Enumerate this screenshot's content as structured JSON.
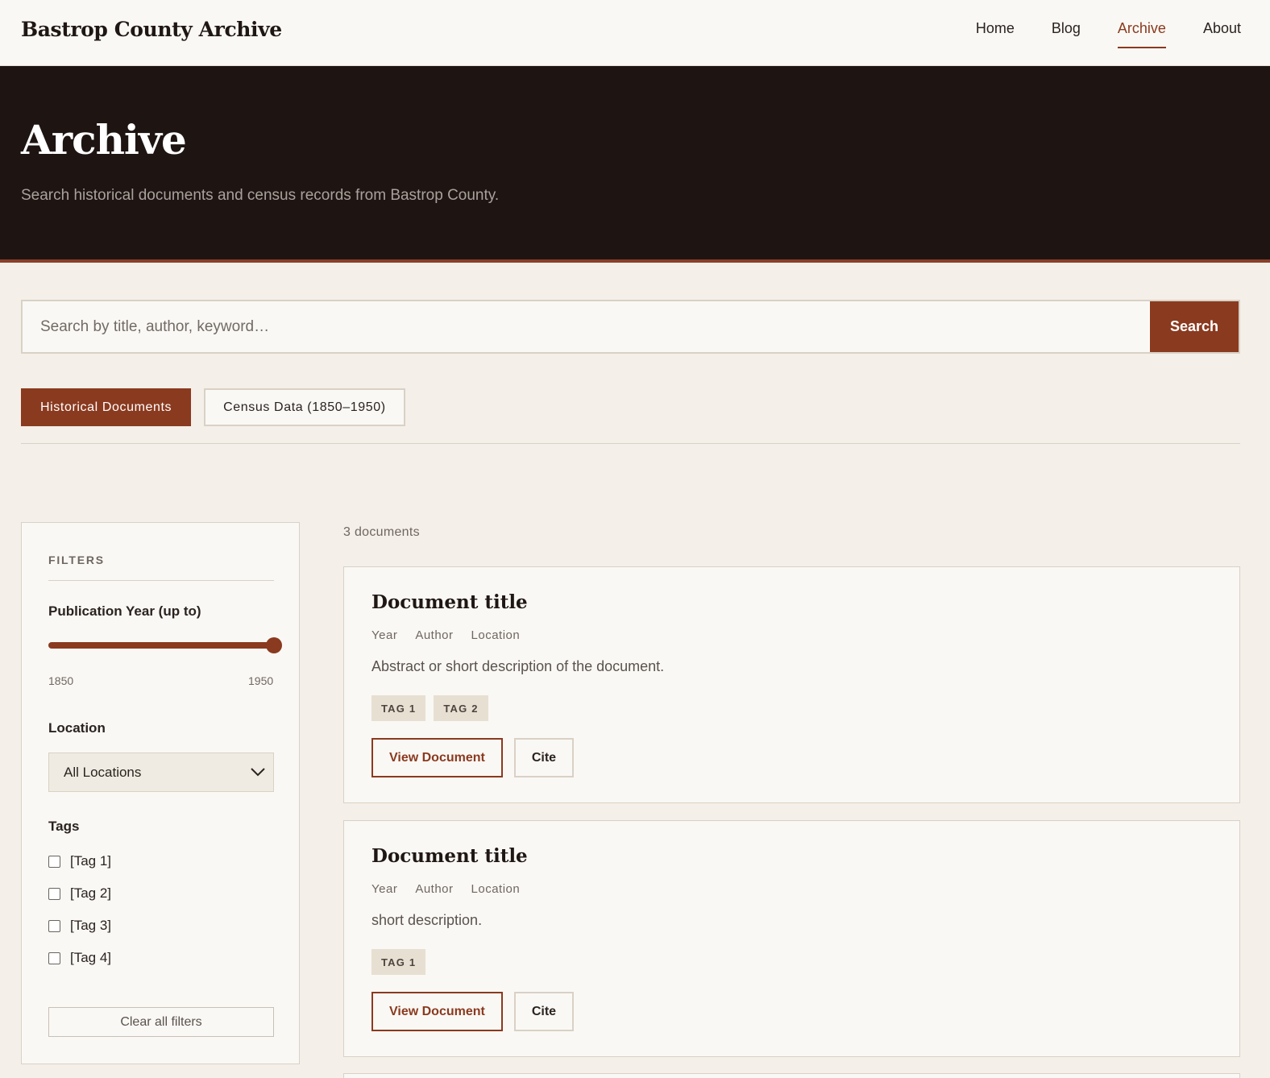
{
  "site": {
    "title": "Bastrop County Archive"
  },
  "nav": [
    {
      "label": "Home",
      "active": false
    },
    {
      "label": "Blog",
      "active": false
    },
    {
      "label": "Archive",
      "active": true
    },
    {
      "label": "About",
      "active": false
    }
  ],
  "hero": {
    "title": "Archive",
    "subtitle": "Search historical documents and census records from Bastrop County."
  },
  "search": {
    "placeholder": "Search by title, author, keyword…",
    "button_label": "Search"
  },
  "tabs": [
    {
      "label": "Historical Documents",
      "active": true
    },
    {
      "label": "Census Data (1850–1950)",
      "active": false
    }
  ],
  "filters": {
    "title": "FILTERS",
    "year": {
      "label": "Publication Year (up to)",
      "min": "1850",
      "max": "1950",
      "value": 1950
    },
    "location": {
      "label": "Location",
      "selected": "All Locations"
    },
    "tags": {
      "label": "Tags",
      "items": [
        "[Tag 1]",
        "[Tag 2]",
        "[Tag 3]",
        "[Tag 4]"
      ]
    },
    "clear_label": "Clear all filters"
  },
  "results": {
    "count_label": "3 documents",
    "cards": [
      {
        "title": "Document title",
        "meta": [
          "Year",
          "Author",
          "Location"
        ],
        "description": "Abstract or short description of the document.",
        "tags": [
          "TAG 1",
          "TAG 2"
        ],
        "view_label": "View Document",
        "cite_label": "Cite"
      },
      {
        "title": "Document title",
        "meta": [
          "Year",
          "Author",
          "Location"
        ],
        "description": "short description.",
        "tags": [
          "TAG 1"
        ],
        "view_label": "View Document",
        "cite_label": "Cite"
      }
    ]
  },
  "colors": {
    "accent": "#8a3a1f",
    "hero_bg": "#1e1513",
    "page_bg": "#f4efe8",
    "card_bg": "#faf8f4",
    "tag_bg": "#e7dfd1"
  }
}
